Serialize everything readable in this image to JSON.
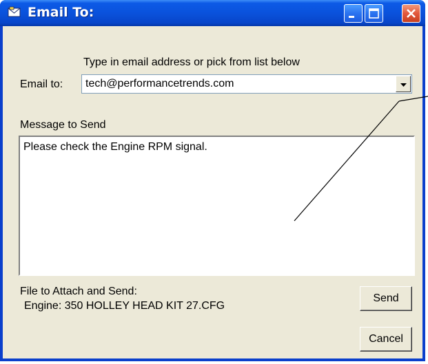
{
  "window": {
    "title": "Email To:",
    "title_icon": "envelope-icon"
  },
  "titlebar_buttons": [
    "minimize",
    "maximize",
    "close"
  ],
  "email": {
    "instruction": "Type in email address or pick from list below",
    "label": "Email to:",
    "value": "tech@performancetrends.com",
    "dropdown_icon": "chevron-down-icon"
  },
  "message": {
    "label": "Message to Send",
    "text": "Please check the Engine RPM signal."
  },
  "attachment": {
    "label": "File to Attach and Send:",
    "file": "Engine: 350 HOLLEY HEAD KIT  27.CFG"
  },
  "buttons": {
    "send": "Send",
    "cancel": "Cancel"
  },
  "colors": {
    "titlebar": "#0a52dc",
    "close_button": "#e2583c",
    "client_bg": "#ece9d8"
  }
}
